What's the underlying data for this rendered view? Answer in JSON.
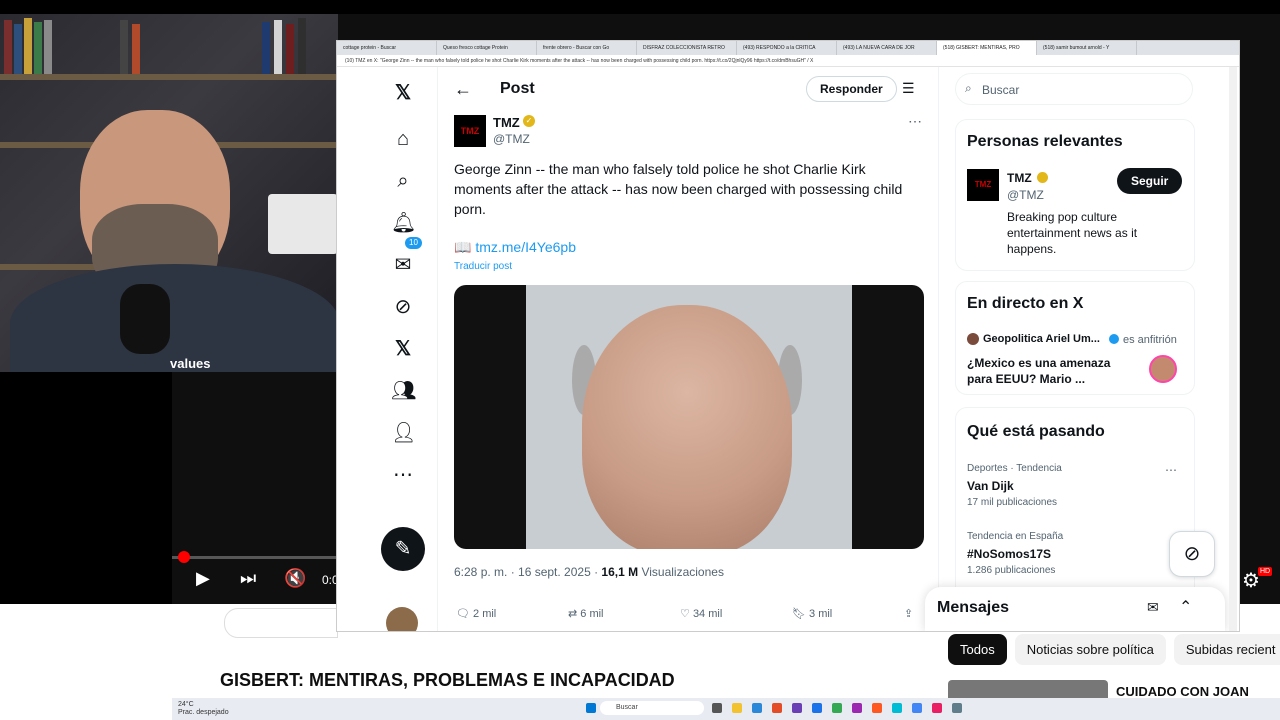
{
  "browser": {
    "tabs": [
      "cottage protein - Buscar",
      "Queso fresco cottage Protein",
      "frente obrero - Buscar con Go",
      "DISFRAZ COLECCIONISTA RETRO",
      "(493) RESPONDO a la CRITICA",
      "(493) LA NUEVA CARA DE JOR",
      "(518) GISBERT: MENTIRAS, PRO",
      "(518) samir bumout arnold - Y"
    ],
    "url": "(10) TMZ en X: \"George Zinn -- the man who falsely told police he shot Charlie Kirk moments after the attack -- has now been charged with possessing child porn. https://t.co/2QjnlQy96 https://t.co/dmBhsuGH\" / X"
  },
  "nav": {
    "notifications_count": "10",
    "items": [
      "home-icon",
      "search-icon",
      "bell-icon",
      "mail-icon",
      "grok-icon",
      "x-logo-icon",
      "communities-icon",
      "profile-icon",
      "more-icon"
    ]
  },
  "post": {
    "header_title": "Post",
    "reply_button": "Responder",
    "author_name": "TMZ",
    "author_handle": "@TMZ",
    "avatar_text": "TMZ",
    "text": "George Zinn -- the man who falsely told police he shot Charlie Kirk moments after the attack -- has now been charged with possessing child porn.",
    "link": "📖 tmz.me/I4Ye6pb",
    "translate": "Traducir post",
    "time": "6:28 p. m. · 16 sept. 2025 · ",
    "views_count": "16,1 M",
    "views_label": " Visualizaciones",
    "replies": "2 mil",
    "reposts": "6 mil",
    "likes": "34 mil",
    "bookmarks": "3 mil"
  },
  "right": {
    "search_placeholder": "Buscar",
    "relevant_title": "Personas relevantes",
    "relevant_name": "TMZ",
    "relevant_handle": "@TMZ",
    "relevant_bio": "Breaking pop culture entertainment news as it happens.",
    "follow_button": "Seguir",
    "live_title": "En directo en X",
    "live_host": "Geopolitica Ariel Um...",
    "live_role": "es anfitrión",
    "live_space": "¿Mexico es una amenaza para EEUU? Mario ...",
    "trending_title": "Qué está pasando",
    "trends": [
      {
        "meta": "Deportes · Tendencia",
        "name": "Van Dijk",
        "count": "17 mil publicaciones"
      },
      {
        "meta": "Tendencia en España",
        "name": "#NoSomos17S",
        "count": "1.286 publicaciones"
      }
    ],
    "messages_title": "Mensajes"
  },
  "youtube": {
    "video_title": "GISBERT: MENTIRAS, PROBLEMAS E INCAPACIDAD",
    "chips": [
      "Todos",
      "Noticias sobre política",
      "Subidas recient"
    ],
    "rec_title": "CUIDADO CON JOAN",
    "time_display": "0:0",
    "cam_label": "values"
  },
  "taskbar": {
    "search": "Buscar",
    "weather_temp": "24°C",
    "weather_desc": "Prac. despejado"
  },
  "colors": {
    "x_blue": "#1d9bf0",
    "x_text": "#0f1419",
    "x_secondary": "#536471",
    "yt_red": "#ff0000",
    "tmz_verified": "#e2b719"
  }
}
